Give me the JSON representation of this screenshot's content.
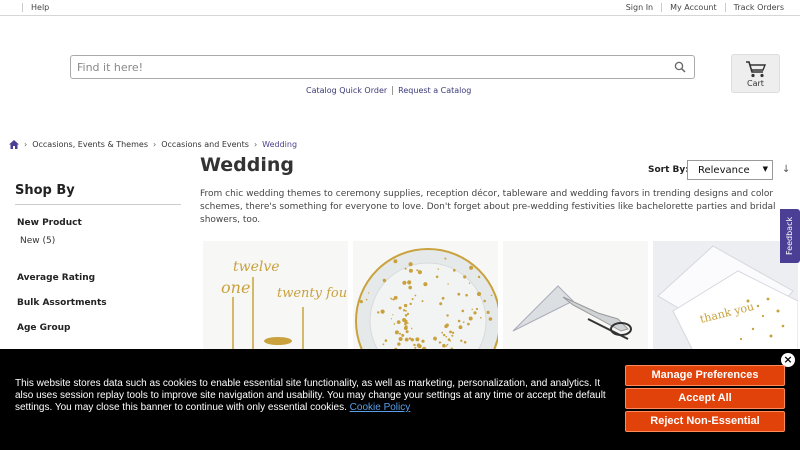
{
  "topbar": {
    "help": "Help",
    "sign_in": "Sign In",
    "my_account": "My Account",
    "track_orders": "Track Orders"
  },
  "search": {
    "placeholder": "Find it here!",
    "quick_order": "Catalog Quick Order",
    "request_catalog": "Request a Catalog"
  },
  "cart": {
    "label": "Cart"
  },
  "breadcrumb": {
    "items": [
      "Occasions, Events & Themes",
      "Occasions and Events"
    ],
    "current": "Wedding"
  },
  "sidebar": {
    "title": "Shop By",
    "facets": {
      "new_product": "New Product",
      "new_value": "New (5)",
      "rating": "Average Rating",
      "bulk": "Bulk Assortments",
      "age": "Age Group"
    }
  },
  "main": {
    "title": "Wedding",
    "sort_label": "Sort By:",
    "sort_value": "Relevance",
    "description": "From chic wedding themes to ceremony supplies, reception décor, tableware and wedding favors in trending designs and color schemes, there's something for everyone to love. Don't forget about pre-wedding festivities like bachelorette parties and bridal showers, too."
  },
  "tiles": {
    "cake_topper_words": [
      "twelve",
      "one",
      "twenty four"
    ],
    "thank_you_text": "thank you"
  },
  "feedback": {
    "label": "Feedback"
  },
  "cookie": {
    "message": "This website stores data such as cookies to enable essential site functionality, as well as marketing, personalization, and analytics. It also uses session replay tools to improve site navigation and usability. You may change your settings at any time or accept the default settings. You may close this banner to continue with only essential cookies.",
    "policy_link": "Cookie Policy",
    "manage": "Manage Preferences",
    "accept": "Accept All",
    "reject": "Reject Non-Essential"
  },
  "colors": {
    "accent": "#4a3f94",
    "cookie_button": "#e0420a",
    "gold": "#c9a23e"
  }
}
